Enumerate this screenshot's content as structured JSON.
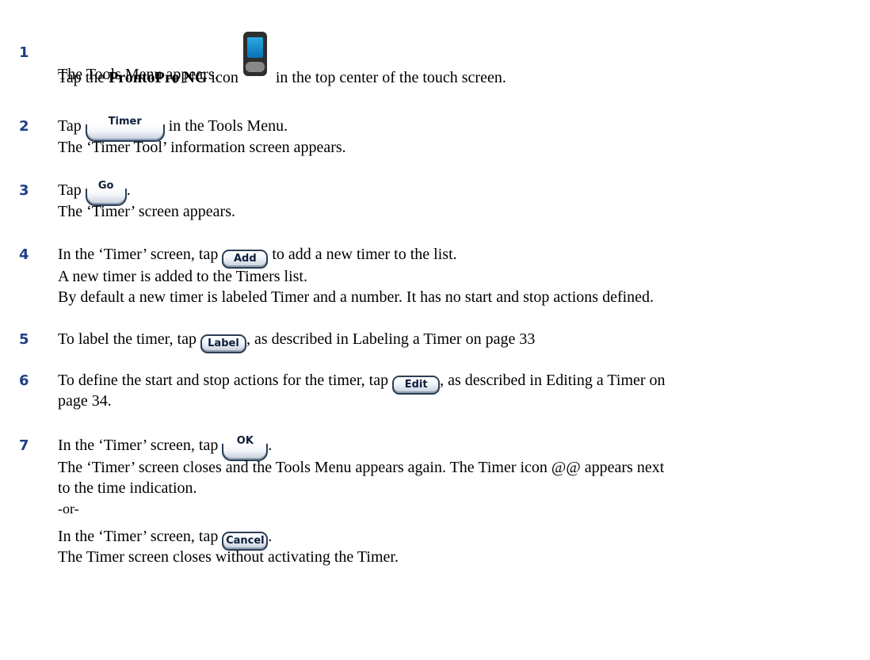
{
  "steps": [
    {
      "number": "1",
      "lines": [
        {
          "pre": "Tap the ",
          "bold": "ProntoPro NG",
          "mid": " icon",
          "post": " in the top center of the touch screen."
        },
        "The Tools Menu appears."
      ]
    },
    {
      "number": "2",
      "pre": "Tap ",
      "button": "Timer",
      "post": " in the Tools Menu.",
      "sub": "The ‘Timer Tool’ information screen appears."
    },
    {
      "number": "3",
      "pre": "Tap ",
      "button": "Go",
      "post": ".",
      "sub": "The ‘Timer’ screen appears."
    },
    {
      "number": "4",
      "pre": "In the ‘Timer’ screen, tap ",
      "button": "Add",
      "post": " to add a new timer to the list.",
      "sub": "A new timer is added to the Timers list.",
      "sub2": "By default a new timer is labeled Timer and a number. It has no start and stop actions defined."
    },
    {
      "number": "5",
      "pre": "To label the timer, tap ",
      "button": "Label",
      "post": ", as described in Labeling a Timer on page 33"
    },
    {
      "number": "6",
      "pre": "To define the start and stop actions for the timer, tap ",
      "button": "Edit",
      "post": ", as described in Editing a Timer on",
      "sub": "page 34."
    },
    {
      "number": "7",
      "pre": "In the ‘Timer’ screen, tap ",
      "button": "OK",
      "post": ".",
      "sub": "The ‘Timer’ screen closes and the Tools Menu appears again. The Timer icon @@ appears next",
      "sub2": "to the time indication.",
      "or": "-or-",
      "alt_pre": "In the ‘Timer’ screen, tap ",
      "alt_button": "Cancel",
      "alt_post": ".",
      "alt_sub": "The Timer screen closes without activating the Timer."
    }
  ],
  "icons": {
    "device": "prontopro-device-icon"
  },
  "colors": {
    "step_number": "#1f3f86",
    "button_border": "#2b3e55"
  }
}
